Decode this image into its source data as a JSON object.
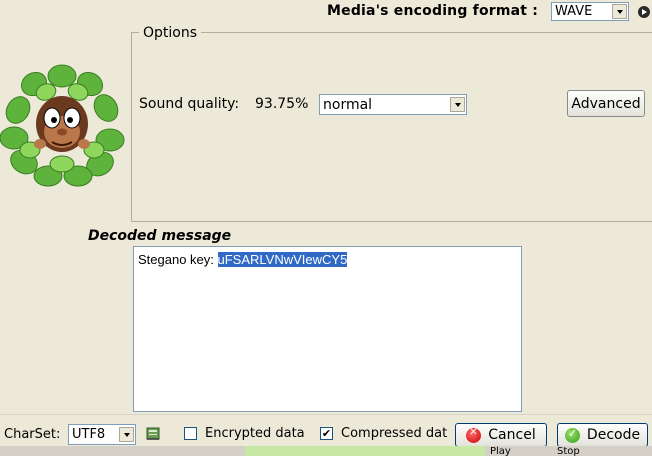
{
  "header": {
    "format_label": "Media's encoding format :",
    "format_value": "WAVE"
  },
  "options": {
    "legend": "Options",
    "sound_quality_label": "Sound quality:",
    "sound_quality_value": "93.75%",
    "quality_select_value": "normal",
    "advanced_label": "Advanced"
  },
  "decoded": {
    "label": "Decoded message",
    "key_prefix": "Stegano key: ",
    "key_value": "uFSARLVNwVIewCY5"
  },
  "bottom": {
    "charset_label": "CharSet:",
    "charset_value": "UTF8",
    "encrypted_label": "Encrypted data",
    "encrypted_checked": false,
    "compressed_label": "Compressed dat",
    "compressed_checked": true,
    "compressed_mark": "✔",
    "cancel_label": "Cancel",
    "decode_label": "Decode"
  },
  "underlying": {
    "play_label": "Play",
    "stop_label": "Stop"
  },
  "colors": {
    "background": "#ece9d8",
    "selection": "#316ac5",
    "leaf_green": "#6cc24a",
    "cancel_red": "#c80000",
    "decode_green": "#2f9a16"
  },
  "icons": {
    "mascot": "mascot-in-leaves",
    "charset": "book-icon",
    "cancel": "cancel-icon",
    "decode": "check-icon",
    "play_mini": "play-icon"
  }
}
